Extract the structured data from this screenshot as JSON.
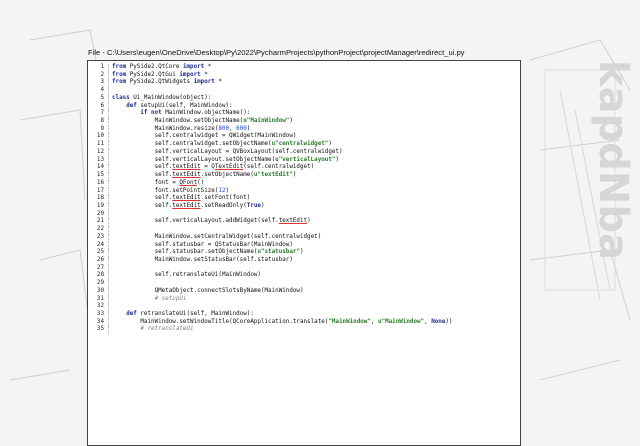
{
  "file_header": "File - C:\\Users\\eugen\\OneDrive\\Desktop\\Py\\2022\\PycharmProjects\\pythonProject\\projectManager\\redirect_ui.py",
  "code_lines": [
    {
      "n": "1",
      "indent": "",
      "tokens": [
        [
          "kw",
          "from"
        ],
        [
          "t",
          " PySide2.QtCore "
        ],
        [
          "kw",
          "import"
        ],
        [
          "t",
          " *"
        ]
      ]
    },
    {
      "n": "2",
      "indent": "",
      "tokens": [
        [
          "kw",
          "from"
        ],
        [
          "t",
          " PySide2.QtGui "
        ],
        [
          "kw",
          "import"
        ],
        [
          "t",
          " *"
        ]
      ]
    },
    {
      "n": "3",
      "indent": "",
      "tokens": [
        [
          "kw",
          "from"
        ],
        [
          "t",
          " PySide2.QtWidgets "
        ],
        [
          "kw",
          "import"
        ],
        [
          "t",
          " *"
        ]
      ]
    },
    {
      "n": "4",
      "indent": "",
      "tokens": []
    },
    {
      "n": "5",
      "indent": "",
      "tokens": [
        [
          "kw",
          "class"
        ],
        [
          "t",
          " Ui_MainWindow(object):"
        ]
      ]
    },
    {
      "n": "6",
      "indent": "    ",
      "tokens": [
        [
          "kw",
          "def"
        ],
        [
          "t",
          " setupUi(self, MainWindow):"
        ]
      ]
    },
    {
      "n": "7",
      "indent": "        ",
      "tokens": [
        [
          "kw",
          "if not"
        ],
        [
          "t",
          " MainWindow.objectName():"
        ]
      ]
    },
    {
      "n": "8",
      "indent": "            ",
      "tokens": [
        [
          "t",
          "MainWindow.setObjectName("
        ],
        [
          "str",
          "u\"MainWindow\""
        ],
        [
          "t",
          ")"
        ]
      ]
    },
    {
      "n": "9",
      "indent": "            ",
      "tokens": [
        [
          "t",
          "MainWindow.resize("
        ],
        [
          "num",
          "800"
        ],
        [
          "t",
          ", "
        ],
        [
          "num",
          "600"
        ],
        [
          "t",
          ")"
        ]
      ]
    },
    {
      "n": "10",
      "indent": "            ",
      "tokens": [
        [
          "t",
          "self.centralwidget = QWidget(MainWindow)"
        ]
      ]
    },
    {
      "n": "11",
      "indent": "            ",
      "tokens": [
        [
          "t",
          "self.centralwidget.setObjectName("
        ],
        [
          "str",
          "u\"centralwidget\""
        ],
        [
          "t",
          ")"
        ]
      ]
    },
    {
      "n": "12",
      "indent": "            ",
      "tokens": [
        [
          "t",
          "self.verticalLayout = QVBoxLayout(self.centralwidget)"
        ]
      ]
    },
    {
      "n": "13",
      "indent": "            ",
      "tokens": [
        [
          "t",
          "self.verticalLayout.setObjectName("
        ],
        [
          "str",
          "u\"verticalLayout\""
        ],
        [
          "t",
          ")"
        ]
      ]
    },
    {
      "n": "14",
      "indent": "            ",
      "tokens": [
        [
          "t",
          "self."
        ],
        [
          "ul",
          "textEdit"
        ],
        [
          "t",
          " = Q"
        ],
        [
          "ul",
          "TextEdit"
        ],
        [
          "t",
          "(self.centralwidget)"
        ]
      ]
    },
    {
      "n": "15",
      "indent": "            ",
      "tokens": [
        [
          "t",
          "self."
        ],
        [
          "ul",
          "textEdit"
        ],
        [
          "t",
          ".setObjectName("
        ],
        [
          "str",
          "u\"textEdit\""
        ],
        [
          "t",
          ")"
        ]
      ]
    },
    {
      "n": "16",
      "indent": "            ",
      "tokens": [
        [
          "t",
          "font = "
        ],
        [
          "ul",
          "QFont"
        ],
        [
          "t",
          "()"
        ]
      ]
    },
    {
      "n": "17",
      "indent": "            ",
      "tokens": [
        [
          "t",
          "font.setPointSize("
        ],
        [
          "num",
          "12"
        ],
        [
          "t",
          ")"
        ]
      ]
    },
    {
      "n": "18",
      "indent": "            ",
      "tokens": [
        [
          "t",
          "self."
        ],
        [
          "ul",
          "textEdit"
        ],
        [
          "t",
          ".setFont(font)"
        ]
      ]
    },
    {
      "n": "19",
      "indent": "            ",
      "tokens": [
        [
          "t",
          "self."
        ],
        [
          "ul",
          "textEdit"
        ],
        [
          "t",
          ".setReadOnly("
        ],
        [
          "kw",
          "True"
        ],
        [
          "t",
          ")"
        ]
      ]
    },
    {
      "n": "20",
      "indent": "",
      "tokens": []
    },
    {
      "n": "21",
      "indent": "            ",
      "tokens": [
        [
          "t",
          "self.verticalLayout.addWidget(self."
        ],
        [
          "ul",
          "textEdit"
        ],
        [
          "t",
          ")"
        ]
      ]
    },
    {
      "n": "22",
      "indent": "",
      "tokens": []
    },
    {
      "n": "23",
      "indent": "            ",
      "tokens": [
        [
          "t",
          "MainWindow.setCentralWidget(self.centralwidget)"
        ]
      ]
    },
    {
      "n": "24",
      "indent": "            ",
      "tokens": [
        [
          "t",
          "self.statusbar = QStatusBar(MainWindow)"
        ]
      ]
    },
    {
      "n": "25",
      "indent": "            ",
      "tokens": [
        [
          "t",
          "self.statusbar.setObjectName("
        ],
        [
          "str",
          "u\"statusbar\""
        ],
        [
          "t",
          ")"
        ]
      ]
    },
    {
      "n": "26",
      "indent": "            ",
      "tokens": [
        [
          "t",
          "MainWindow.setStatusBar(self.statusbar)"
        ]
      ]
    },
    {
      "n": "27",
      "indent": "",
      "tokens": []
    },
    {
      "n": "28",
      "indent": "            ",
      "tokens": [
        [
          "t",
          "self.retranslateUi(MainWindow)"
        ]
      ]
    },
    {
      "n": "29",
      "indent": "",
      "tokens": []
    },
    {
      "n": "30",
      "indent": "            ",
      "tokens": [
        [
          "t",
          "QMetaObject.connectSlotsByName(MainWindow)"
        ]
      ]
    },
    {
      "n": "31",
      "indent": "            ",
      "tokens": [
        [
          "cm",
          "# setupUi"
        ]
      ]
    },
    {
      "n": "32",
      "indent": "",
      "tokens": []
    },
    {
      "n": "33",
      "indent": "    ",
      "tokens": [
        [
          "kw",
          "def"
        ],
        [
          "t",
          " retranslateUi(self, MainWindow):"
        ]
      ]
    },
    {
      "n": "34",
      "indent": "        ",
      "tokens": [
        [
          "t",
          "MainWindow.setWindowTitle(QCoreApplication.translate("
        ],
        [
          "str",
          "\"MainWindow\""
        ],
        [
          "t",
          ", "
        ],
        [
          "str",
          "u\"MainWindow\""
        ],
        [
          "t",
          ", "
        ],
        [
          "kw",
          "None"
        ],
        [
          "t",
          "))"
        ]
      ]
    },
    {
      "n": "35",
      "indent": "        ",
      "tokens": [
        [
          "cm",
          "# retranslateUi"
        ]
      ]
    }
  ]
}
